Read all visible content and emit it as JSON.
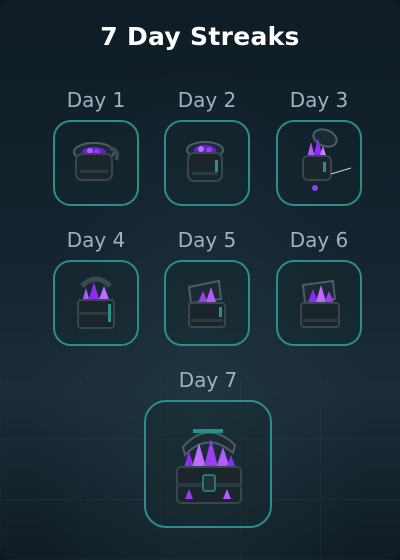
{
  "title": "7 Day Streaks",
  "colors": {
    "tile_border": "#2a8f86",
    "crystal": "#8b2cf5",
    "label": "#9fb2bd"
  },
  "days": [
    {
      "label": "Day 1",
      "icon": "small-gem-jar-icon"
    },
    {
      "label": "Day 2",
      "icon": "small-gem-jar-icon"
    },
    {
      "label": "Day 3",
      "icon": "open-gem-jar-icon"
    },
    {
      "label": "Day 4",
      "icon": "gem-crate-icon"
    },
    {
      "label": "Day 5",
      "icon": "gem-box-icon"
    },
    {
      "label": "Day 6",
      "icon": "gem-box-icon"
    },
    {
      "label": "Day 7",
      "icon": "gem-chest-icon"
    }
  ]
}
